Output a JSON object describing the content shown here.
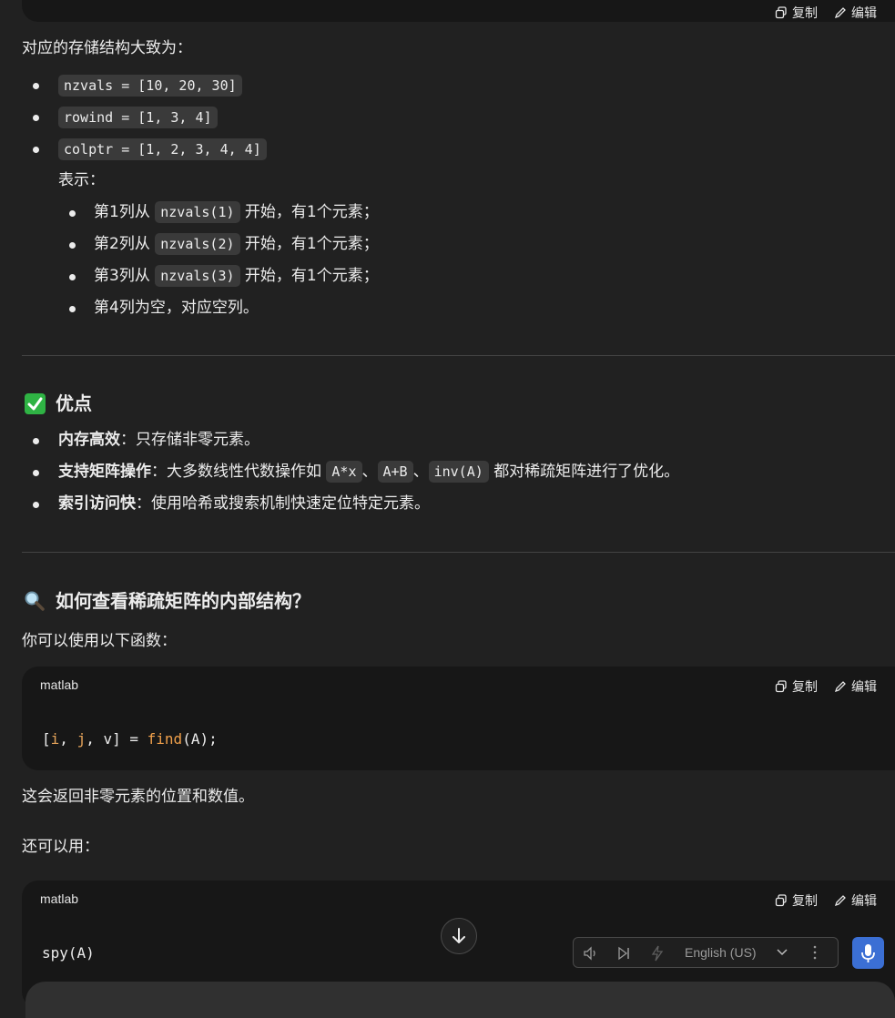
{
  "top_actions": {
    "copy": "复制",
    "edit": "编辑"
  },
  "storage_intro": "对应的存储结构大致为：",
  "storage_items": [
    "nzvals = [10, 20, 30]",
    "rowind = [1, 3, 4]",
    "colptr = [1, 2, 3, 4, 4]"
  ],
  "means_label": "表示：",
  "columns": [
    {
      "pre": "第1列从",
      "code": "nzvals(1)",
      "post": "开始，有1个元素；"
    },
    {
      "pre": "第2列从",
      "code": "nzvals(2)",
      "post": "开始，有1个元素；"
    },
    {
      "pre": "第3列从",
      "code": "nzvals(3)",
      "post": "开始，有1个元素；"
    },
    {
      "pre": "第4列为空，对应空列。"
    }
  ],
  "advantages": {
    "emoji": "✅",
    "title": "优点",
    "items": [
      {
        "bold": "内存高效",
        "text": "：只存储非零元素。"
      },
      {
        "bold": "支持矩阵操作",
        "text": "：大多数线性代数操作如",
        "codes": [
          "A*x",
          "A+B",
          "inv(A)"
        ],
        "sep": "、",
        "tail": "都对稀疏矩阵进行了优化。"
      },
      {
        "bold": "索引访问快",
        "text": "：使用哈希或搜索机制快速定位特定元素。"
      }
    ]
  },
  "inspect": {
    "emoji": "🔍",
    "title": "如何查看稀疏矩阵的内部结构？",
    "intro": "你可以使用以下函数：",
    "code1": {
      "lang": "matlab",
      "copy": "复制",
      "edit": "编辑",
      "open": "[",
      "i": "i",
      "comma1": ",",
      "j": "j",
      "comma2": ",",
      "rest": "v] =",
      "fn": "find",
      "args": "(A);"
    },
    "after1": "这会返回非零元素的位置和数值。",
    "also": "还可以用：",
    "code2": {
      "lang": "matlab",
      "copy": "复制",
      "edit": "编辑",
      "code": "spy(A)"
    }
  },
  "tts": {
    "language": "English (US)"
  },
  "colors": {
    "background": "#212121",
    "code_bg": "#171717",
    "pill_bg": "#3a3a3a",
    "mic_button": "#3b6fd4",
    "check_green": "#2fb344"
  }
}
